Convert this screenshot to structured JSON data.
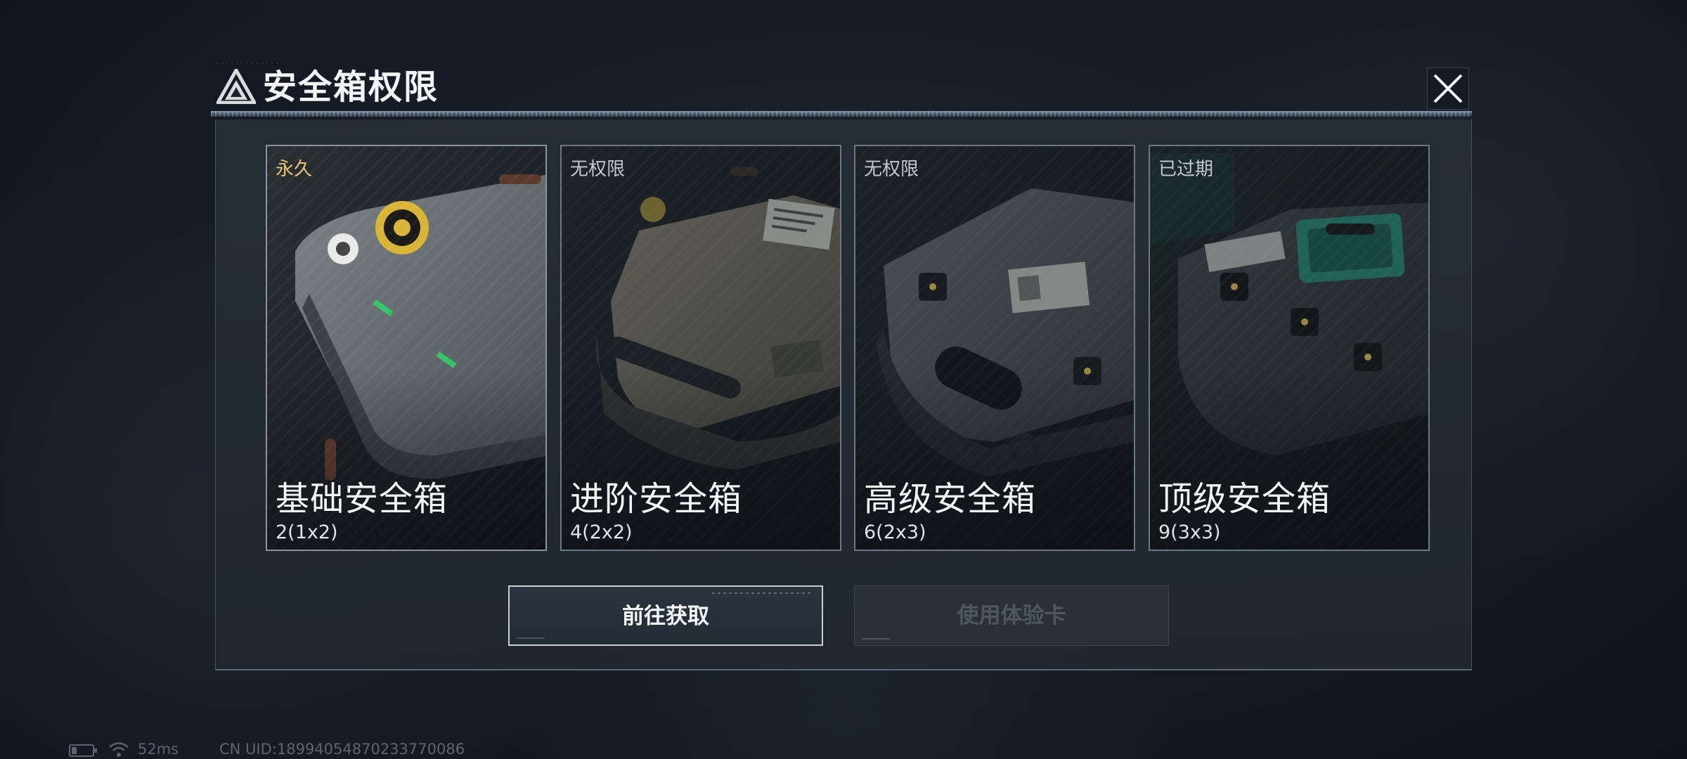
{
  "dialog": {
    "title": "安全箱权限",
    "close_icon": "close-icon",
    "logo_icon": "triangle-logo-icon"
  },
  "cards": [
    {
      "status": "永久",
      "status_color": "#e7c66a",
      "name": "基础安全箱",
      "size": "2(1x2)",
      "selected": true
    },
    {
      "status": "无权限",
      "status_color": "#c4c8cc",
      "name": "进阶安全箱",
      "size": "4(2x2)",
      "selected": false
    },
    {
      "status": "无权限",
      "status_color": "#c4c8cc",
      "name": "高级安全箱",
      "size": "6(2x3)",
      "selected": false
    },
    {
      "status": "已过期",
      "status_color": "#c4c8cc",
      "name": "顶级安全箱",
      "size": "9(3x3)",
      "selected": false
    }
  ],
  "buttons": {
    "primary_label": "前往获取",
    "disabled_label": "使用体验卡"
  },
  "status_bar": {
    "battery_icon": "battery-icon",
    "wifi_icon": "wifi-icon",
    "ping": "52ms",
    "uid": "CN UID:18994054870233770086"
  }
}
